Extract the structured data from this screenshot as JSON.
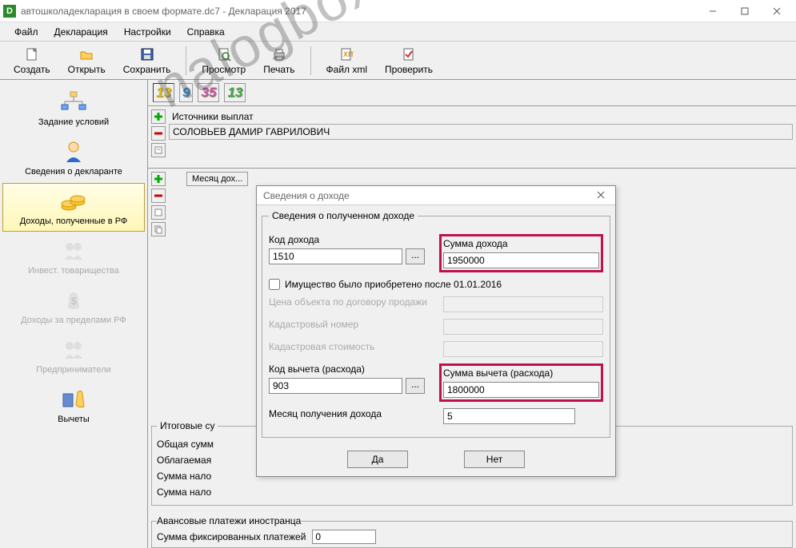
{
  "window": {
    "title": "автошколадекларация в своем формате.dc7 - Декларация 2017",
    "app_badge": "D"
  },
  "menu": {
    "file": "Файл",
    "decl": "Декларация",
    "settings": "Настройки",
    "help": "Справка"
  },
  "toolbar": {
    "create": "Создать",
    "open": "Открыть",
    "save": "Сохранить",
    "preview": "Просмотр",
    "print": "Печать",
    "xml": "Файл xml",
    "check": "Проверить"
  },
  "sidebar": {
    "conditions": "Задание условий",
    "declarant": "Сведения о декларанте",
    "income_rf": "Доходы, полученные в РФ",
    "invest": "Инвест. товарищества",
    "income_foreign": "Доходы за пределами РФ",
    "entrepreneurs": "Предприниматели",
    "deductions": "Вычеты"
  },
  "tabs": {
    "a": "13",
    "b": "9",
    "c": "35",
    "d": "13"
  },
  "sources": {
    "header": "Источники выплат",
    "row1": "СОЛОВЬЕВ ДАМИР ГАВРИЛОВИЧ"
  },
  "month_header": "Месяц дох...",
  "totals": {
    "legend": "Итоговые су",
    "total": "Общая сумм",
    "taxable": "Облагаемая",
    "tax": "Сумма нало",
    "tax2": "Сумма нало"
  },
  "advance": {
    "legend": "Авансовые платежи иностранца",
    "fixed": "Сумма фиксированных платежей",
    "value": "0"
  },
  "dialog": {
    "title": "Сведения о доходе",
    "legend": "Сведения о полученном доходе",
    "code_label": "Код дохода",
    "code_value": "1510",
    "amount_label": "Сумма дохода",
    "amount_value": "1950000",
    "property_chk": "Имущество было приобретено после 01.01.2016",
    "price_label": "Цена объекта по договору продажи",
    "cadastral_num": "Кадастровый номер",
    "cadastral_val": "Кадастровая стоимость",
    "deduct_code_label": "Код вычета (расхода)",
    "deduct_code_value": "903",
    "deduct_amount_label": "Сумма вычета (расхода)",
    "deduct_amount_value": "1800000",
    "month_label": "Месяц получения дохода",
    "month_value": "5",
    "ok": "Да",
    "cancel": "Нет"
  },
  "watermark": "nalogbox.ru"
}
